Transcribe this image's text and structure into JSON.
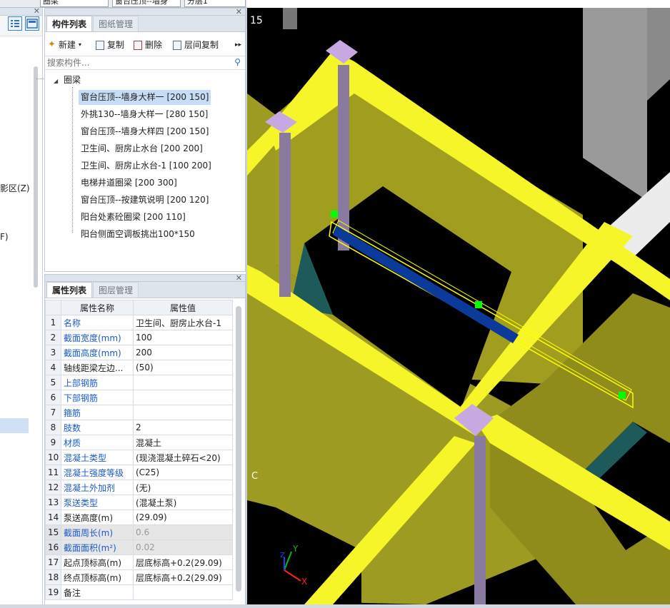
{
  "topbar": {
    "combo1": "圈梁",
    "combo2": "窗台压顶--墙身",
    "combo3": "分层1"
  },
  "left_strip": {
    "partial1": "影区(Z)",
    "partial2": "F)"
  },
  "component_panel": {
    "tabs": [
      "构件列表",
      "图纸管理"
    ],
    "toolbar": {
      "new": "新建",
      "copy": "复制",
      "delete": "删除",
      "floor_copy": "层间复制"
    },
    "search_placeholder": "搜索构件...",
    "tree_root": "圈梁",
    "items": [
      "窗台压顶--墙身大样一 [200 150]",
      "外挑130--墙身大样一 [280 150]",
      "窗台压顶--墙身大样四 [200 150]",
      "卫生间、厨房止水台 [200 200]",
      "卫生间、厨房止水台-1 [100 200]",
      "电梯井道圈梁 [200 300]",
      "窗台压顶--按建筑说明 [200 120]",
      "阳台处素砼圈梁 [200 110]",
      "阳台侧面空调板挑出100*150"
    ],
    "selected_index": 0
  },
  "property_panel": {
    "tabs": [
      "属性列表",
      "图层管理"
    ],
    "headers": [
      "属性名称",
      "属性值"
    ],
    "rows": [
      {
        "n": "1",
        "name": "名称",
        "value": "卫生间、厨房止水台-1",
        "blue": true
      },
      {
        "n": "2",
        "name": "截面宽度(mm)",
        "value": "100",
        "blue": true
      },
      {
        "n": "3",
        "name": "截面高度(mm)",
        "value": "200",
        "blue": true
      },
      {
        "n": "4",
        "name": "轴线距梁左边...",
        "value": "(50)",
        "blue": false
      },
      {
        "n": "5",
        "name": "上部钢筋",
        "value": "",
        "blue": true
      },
      {
        "n": "6",
        "name": "下部钢筋",
        "value": "",
        "blue": true
      },
      {
        "n": "7",
        "name": "箍筋",
        "value": "",
        "blue": true
      },
      {
        "n": "8",
        "name": "肢数",
        "value": "2",
        "blue": true
      },
      {
        "n": "9",
        "name": "材质",
        "value": "混凝土",
        "blue": true
      },
      {
        "n": "10",
        "name": "混凝土类型",
        "value": "(现浇混凝土碎石<20)",
        "blue": true
      },
      {
        "n": "11",
        "name": "混凝土强度等级",
        "value": "(C25)",
        "blue": true
      },
      {
        "n": "12",
        "name": "混凝土外加剂",
        "value": "(无)",
        "blue": true
      },
      {
        "n": "13",
        "name": "泵送类型",
        "value": "(混凝土泵)",
        "blue": true
      },
      {
        "n": "14",
        "name": "泵送高度(m)",
        "value": "(29.09)",
        "blue": false
      },
      {
        "n": "15",
        "name": "截面周长(m)",
        "value": "0.6",
        "blue": true,
        "disabled": true
      },
      {
        "n": "16",
        "name": "截面面积(m²)",
        "value": "0.02",
        "blue": true,
        "disabled": true
      },
      {
        "n": "17",
        "name": "起点顶标高(m)",
        "value": "层底标高+0.2(29.09)",
        "blue": false
      },
      {
        "n": "18",
        "name": "终点顶标高(m)",
        "value": "层底标高+0.2(29.09)",
        "blue": false
      },
      {
        "n": "19",
        "name": "备注",
        "value": "",
        "blue": false
      }
    ]
  },
  "viewport": {
    "label_top": "15",
    "label_mid": "C",
    "axis_x": "X",
    "axis_y": "Y",
    "axis_z": "Z"
  },
  "colors": {
    "wall": "#a19e1f",
    "beam": "#f5f52a",
    "column": "#c8a8e0",
    "selection": "#ffff00",
    "blue_beam": "#0b3a9a",
    "handle": "#00ff00",
    "dark_teal": "#1f5a5a"
  }
}
